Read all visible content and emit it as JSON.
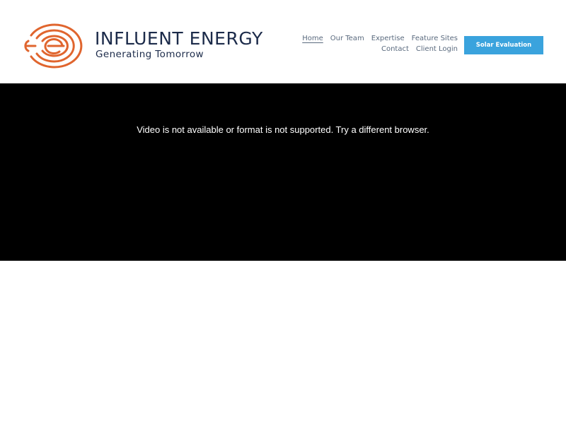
{
  "brand": {
    "name": "INFLUENT ENERGY",
    "tagline": "Generating Tomorrow",
    "logo_icon": "influent-energy-logo-icon",
    "primary_color": "#1c2b4a",
    "accent_color": "#e0652e"
  },
  "nav": {
    "row1": [
      "Home",
      "Our Team",
      "Expertise",
      "Feature Sites"
    ],
    "row2": [
      "Contact",
      "Client Login"
    ],
    "active": "Home"
  },
  "cta": {
    "label": "Solar Evaluation",
    "color": "#3aa3dd"
  },
  "video": {
    "message": "Video is not available or format is not supported. Try a different browser."
  }
}
